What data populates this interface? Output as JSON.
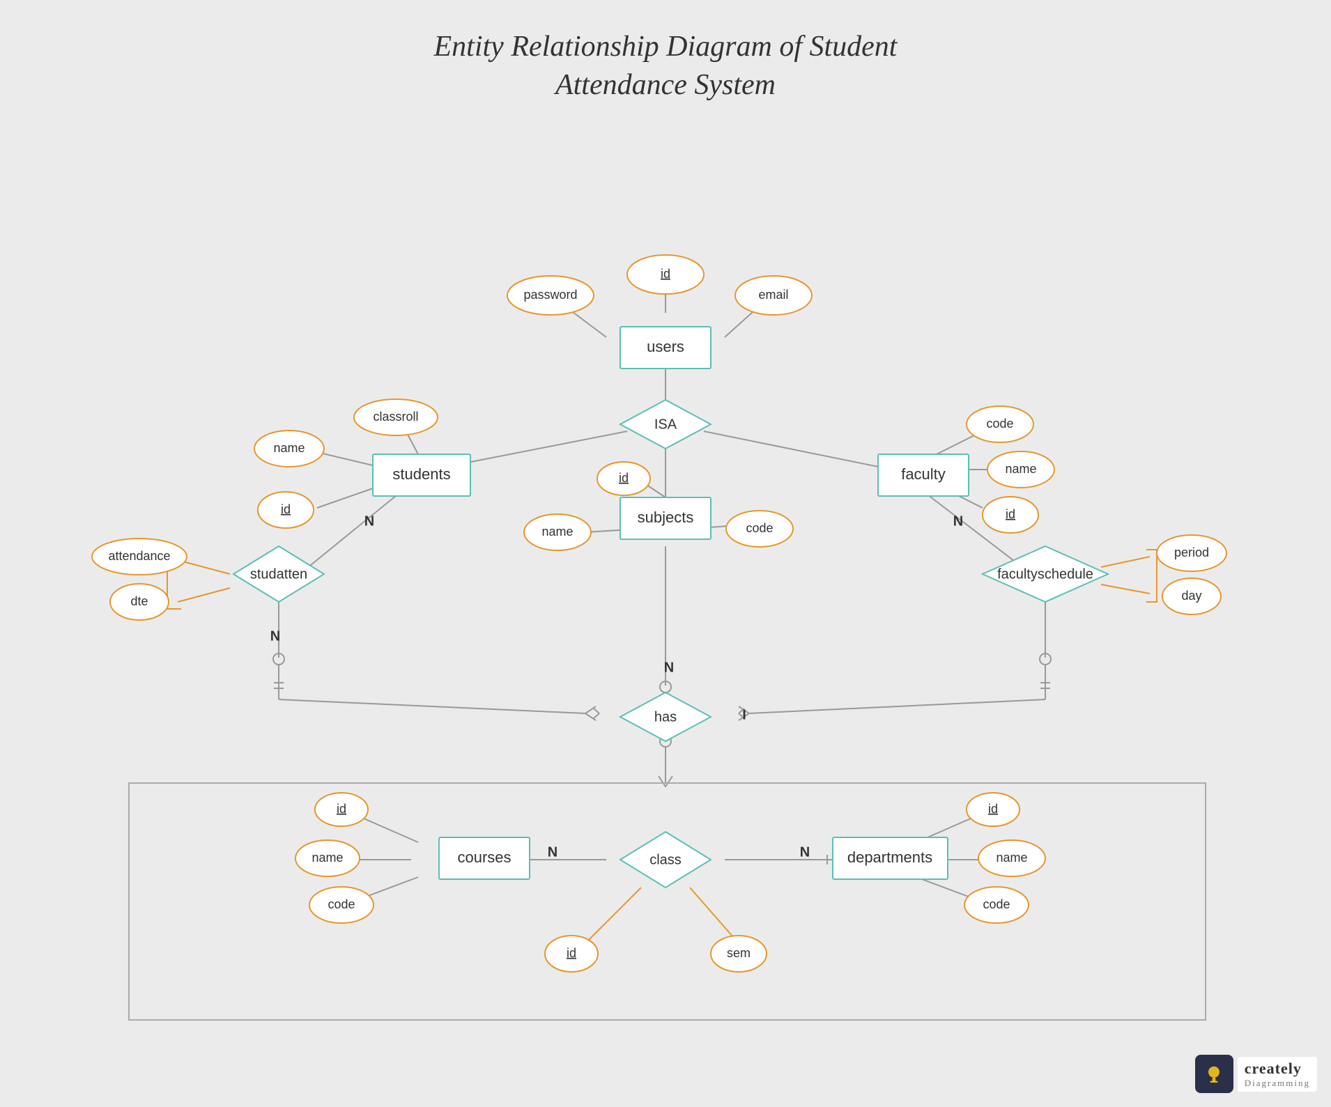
{
  "title": {
    "line1": "Entity Relationship Diagram of Student",
    "line2": "Attendance System"
  },
  "entities": {
    "users": "users",
    "students": "students",
    "faculty": "faculty",
    "subjects": "subjects",
    "courses": "courses",
    "departments": "departments",
    "class": "class"
  },
  "relationships": {
    "isa": "ISA",
    "studatten": "studatten",
    "has": "has",
    "facultyschedule": "facultyschedule"
  },
  "attributes": {
    "users_id": "id",
    "users_password": "password",
    "users_email": "email",
    "students_name": "name",
    "students_id": "id",
    "students_classroll": "classroll",
    "faculty_code": "code",
    "faculty_name": "name",
    "faculty_id": "id",
    "subjects_id": "id",
    "subjects_name": "name",
    "subjects_code": "code",
    "studatten_attendance": "attendance",
    "studatten_dte": "dte",
    "facultyschedule_period": "period",
    "facultyschedule_day": "day",
    "courses_id": "id",
    "courses_name": "name",
    "courses_code": "code",
    "departments_id": "id",
    "departments_name": "name",
    "departments_code": "code",
    "class_id": "id",
    "class_sem": "sem"
  },
  "cardinality": {
    "n1": "N",
    "n2": "N",
    "n3": "N",
    "n4": "N"
  },
  "colors": {
    "entity_stroke": "#5bbfb5",
    "attr_stroke": "#e8962a",
    "connector": "#999999",
    "connector_orange": "#e8962a",
    "background": "#ebebeb"
  },
  "logo": {
    "name": "creately",
    "sub": "Diagramming"
  }
}
